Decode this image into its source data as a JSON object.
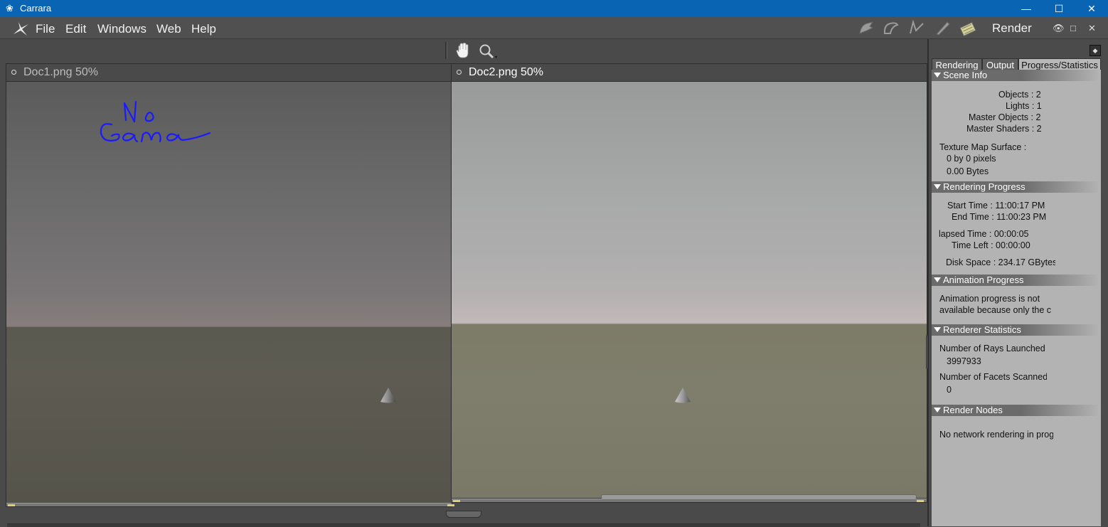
{
  "window": {
    "title": "Carrara",
    "minimize": "—",
    "maximize": "☐",
    "close": "✕"
  },
  "menu": {
    "items": [
      "File",
      "Edit",
      "Windows",
      "Web",
      "Help"
    ],
    "room": "Render",
    "small_buttons": [
      "👁",
      "□",
      "✕"
    ]
  },
  "docs": [
    {
      "title": "Doc1.png 50%",
      "annotation": [
        "No",
        "Gama"
      ]
    },
    {
      "title": "Doc2.png 50%"
    }
  ],
  "panel": {
    "tabs": [
      "Rendering",
      "Output",
      "Progress/Statistics"
    ],
    "active_tab": "Progress/Statistics",
    "scene_info": {
      "header": "Scene Info",
      "objects": "Objects : 2",
      "lights": "Lights : 1",
      "master_objects": "Master Objects : 2",
      "master_shaders": "Master Shaders : 2",
      "texture_label": "Texture Map Surface :",
      "texture_size": "0 by 0 pixels",
      "texture_bytes": "0.00 Bytes"
    },
    "rendering_progress": {
      "header": "Rendering Progress",
      "start": "Start Time : 11:00:17 PM",
      "end": "End Time : 11:00:23 PM",
      "elapsed": "lapsed Time : 00:00:05",
      "left": "Time Left : 00:00:00",
      "disk": "Disk Space : 234.17 GBytes"
    },
    "animation_progress": {
      "header": "Animation Progress",
      "line1": "Animation progress is not",
      "line2": "available because only the c"
    },
    "renderer_statistics": {
      "header": "Renderer Statistics",
      "rays_label": "Number of Rays Launched",
      "rays_value": "3997933",
      "facets_label": "Number of Facets Scanned",
      "facets_value": "0"
    },
    "render_nodes": {
      "header": "Render Nodes",
      "text": "No network rendering in progress"
    }
  },
  "colors": {
    "titlebar": "#0a64b4",
    "annotation": "#1a1aff",
    "marker": "#e0d070"
  }
}
